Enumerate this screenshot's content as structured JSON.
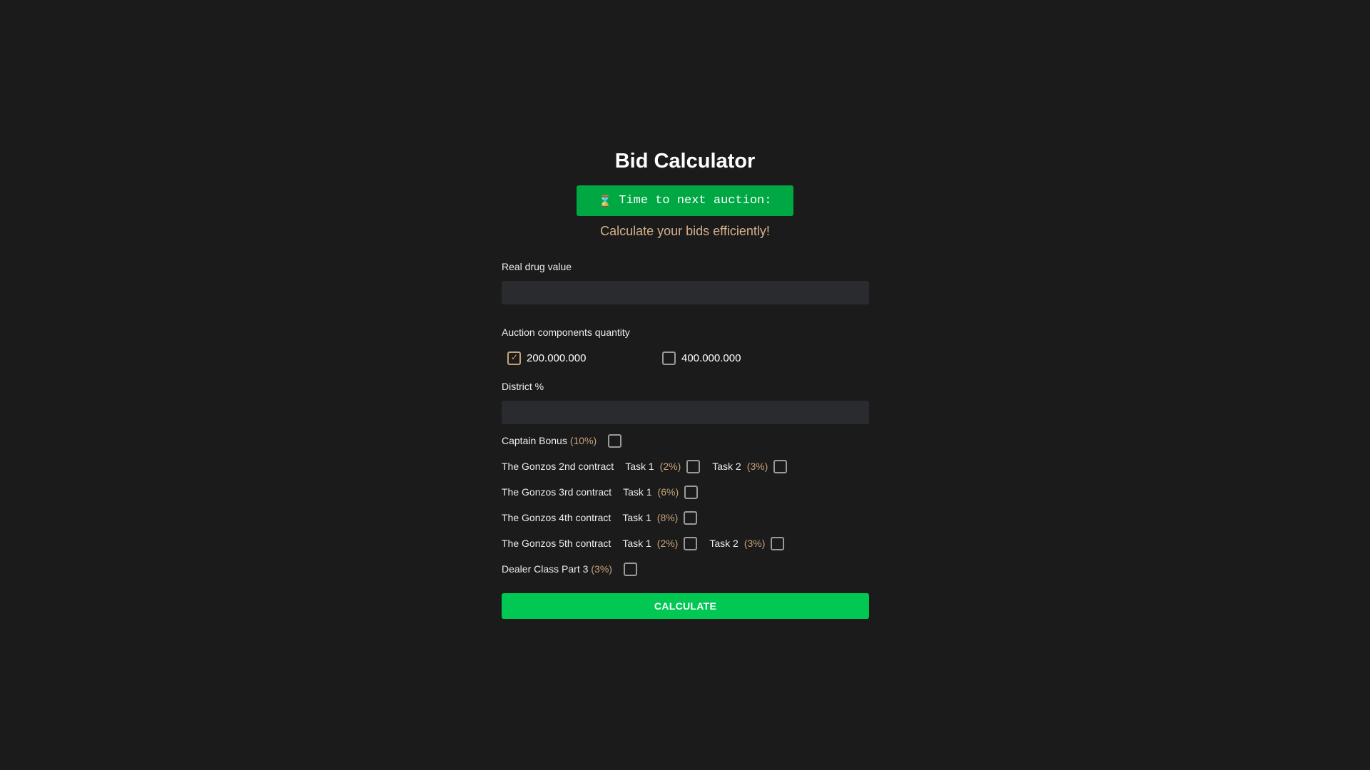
{
  "title": "Bid Calculator",
  "timer": {
    "icon": "hourglass-icon",
    "label": "Time to next auction:"
  },
  "subtitle": "Calculate your bids efficiently!",
  "fields": {
    "real_drug_value": {
      "label": "Real drug value",
      "value": ""
    },
    "auction_quantity": {
      "label": "Auction components quantity",
      "options": [
        {
          "label": "200.000.000",
          "checked": true
        },
        {
          "label": "400.000.000",
          "checked": false
        }
      ]
    },
    "district": {
      "label": "District %",
      "value": ""
    }
  },
  "bonuses": {
    "captain": {
      "label": "Captain Bonus",
      "pct": "(10%)",
      "checked": false
    },
    "gonzos2": {
      "label": "The Gonzos 2nd contract",
      "task1": {
        "label": "Task 1",
        "pct": "(2%)",
        "checked": false
      },
      "task2": {
        "label": "Task 2",
        "pct": "(3%)",
        "checked": false
      }
    },
    "gonzos3": {
      "label": "The Gonzos 3rd contract",
      "task1": {
        "label": "Task 1",
        "pct": "(6%)",
        "checked": false
      }
    },
    "gonzos4": {
      "label": "The Gonzos 4th contract",
      "task1": {
        "label": "Task 1",
        "pct": "(8%)",
        "checked": false
      }
    },
    "gonzos5": {
      "label": "The Gonzos 5th contract",
      "task1": {
        "label": "Task 1",
        "pct": "(2%)",
        "checked": false
      },
      "task2": {
        "label": "Task 2",
        "pct": "(3%)",
        "checked": false
      }
    },
    "dealer": {
      "label": "Dealer Class Part 3",
      "pct": "(3%)",
      "checked": false
    }
  },
  "calculate_label": "CALCULATE",
  "colors": {
    "background": "#1b1b1b",
    "timer_bg": "#00a843",
    "button_bg": "#00c853",
    "accent": "#c7a27a",
    "input_bg": "#2a2b2e"
  }
}
